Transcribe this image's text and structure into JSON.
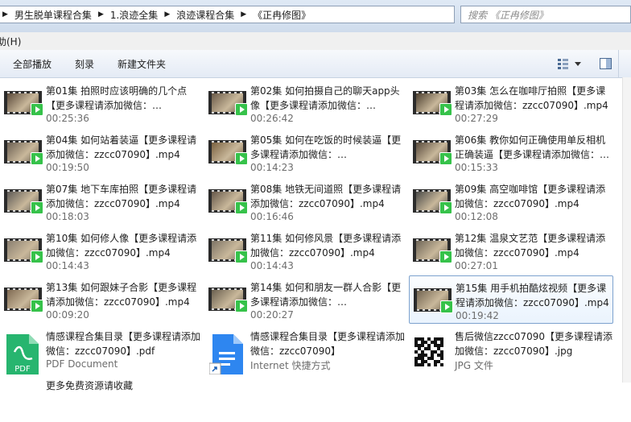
{
  "address": {
    "crumbs": [
      "男生脱单课程合集",
      "1.浪迹全集",
      "浪迹课程合集",
      "《正冉修图》"
    ]
  },
  "search": {
    "placeholder": "搜索 《正冉修图》"
  },
  "menu": {
    "help": "助(H)"
  },
  "toolbar": {
    "play_all": "全部播放",
    "burn": "刻录",
    "new_folder": "新建文件夹"
  },
  "items": [
    {
      "name": "第01集 拍照时应该明确的几个点【更多课程请添加微信：zzcc07090】.mp4",
      "meta": "00:25:36",
      "type": "video",
      "thumb": "#5b4a3a"
    },
    {
      "name": "第02集 如何拍摄自己的聊天app头像【更多课程请添加微信：zzcc07090】.mp4",
      "meta": "00:26:42",
      "type": "video",
      "thumb": "#6a5a48"
    },
    {
      "name": "第03集 怎么在咖啡厅拍照【更多课程请添加微信：zzcc07090】.mp4",
      "meta": "00:27:29",
      "type": "video",
      "thumb": "#4d4030"
    },
    {
      "name": "第04集 如何站着装逼【更多课程请添加微信：zzcc07090】.mp4",
      "meta": "00:19:50",
      "type": "video",
      "thumb": "#6b5f52"
    },
    {
      "name": "第05集 如何在吃饭的时候装逼【更多课程请添加微信：zzcc07090】.mp4",
      "meta": "00:14:23",
      "type": "video",
      "thumb": "#7a6140"
    },
    {
      "name": "第06集 教你如何正确使用单反相机正确装逼【更多课程请添加微信：zzcc07090】.mp4",
      "meta": "00:15:33",
      "type": "video",
      "thumb": "#584a3c"
    },
    {
      "name": "第07集 地下车库拍照【更多课程请添加微信：zzcc07090】.mp4",
      "meta": "00:18:03",
      "type": "video",
      "thumb": "#5e5a56"
    },
    {
      "name": "第08集 地铁无间道照【更多课程请添加微信：zzcc07090】.mp4",
      "meta": "00:16:46",
      "type": "video",
      "thumb": "#66584a"
    },
    {
      "name": "第09集 高空咖啡馆【更多课程请添加微信：zzcc07090】.mp4",
      "meta": "00:12:08",
      "type": "video",
      "thumb": "#4a4a48"
    },
    {
      "name": "第10集 如何修人像【更多课程请添加微信：zzcc07090】.mp4",
      "meta": "00:14:43",
      "type": "video",
      "thumb": "#8a7f70"
    },
    {
      "name": "第11集 如何修风景【更多课程请添加微信：zzcc07090】.mp4",
      "meta": "00:14:43",
      "type": "video",
      "thumb": "#7d7466"
    },
    {
      "name": "第12集 温泉文艺范【更多课程请添加微信：zzcc07090】.mp4",
      "meta": "00:27:01",
      "type": "video",
      "thumb": "#6f6658"
    },
    {
      "name": "第13集 如何跟妹子合影【更多课程请添加微信：zzcc07090】.mp4",
      "meta": "00:09:20",
      "type": "video",
      "thumb": "#7f6a52"
    },
    {
      "name": "第14集 如何和朋友一群人合影【更多课程请添加微信：zzcc07090】.mp4",
      "meta": "00:20:27",
      "type": "video",
      "thumb": "#6a6050"
    },
    {
      "name": "第15集 用手机拍酷炫视频【更多课程请添加微信：zzcc07090】.mp4",
      "meta": "00:19:42",
      "type": "video",
      "thumb": "#746652",
      "selected": true
    },
    {
      "name": "情感课程合集目录【更多课程请添加微信：zzcc07090】.pdf",
      "meta": "PDF Document",
      "type": "pdf"
    },
    {
      "name": "情感课程合集目录【更多课程请添加微信：zzcc07090】",
      "meta": "Internet 快捷方式",
      "type": "doc"
    },
    {
      "name": "售后微信zzcc07090【更多课程请添加微信：zzcc07090】.jpg",
      "meta": "JPG 文件",
      "type": "qr"
    },
    {
      "name": "更多免费资源请收藏",
      "meta": "",
      "type": "partial"
    }
  ]
}
